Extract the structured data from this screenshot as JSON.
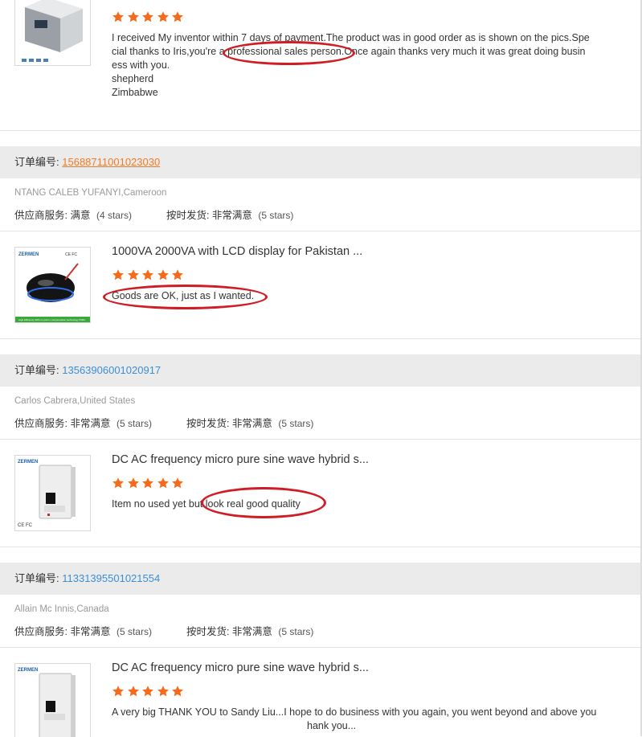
{
  "review1": {
    "text_lines": [
      "I received My inventor within 7 days of payment.The product was in good order as is shown on the pics.Spe",
      "cial thanks to Iris,you're a professional sales person.Once again thanks very much it was great doing busin",
      "ess with you.",
      "shepherd",
      "Zimbabwe"
    ],
    "rating": 5
  },
  "order1": {
    "label": "订单编号:",
    "number": "15688711001023030",
    "buyer": "NTANG CALEB YUFANYI,Cameroon",
    "service_label": "供应商服务:",
    "service_value": "满意",
    "service_stars": "(4 stars)",
    "delivery_label": "按时发货:",
    "delivery_value": "非常满意",
    "delivery_stars": "(5 stars)",
    "product_title": "1000VA 2000VA with LCD display for Pakistan ...",
    "rating": 5,
    "review": "Goods are OK, just as I wanted."
  },
  "order2": {
    "label": "订单编号:",
    "number": "13563906001020917",
    "buyer": "Carlos Cabrera,United States",
    "service_label": "供应商服务:",
    "service_value": "非常满意",
    "service_stars": "(5 stars)",
    "delivery_label": "按时发货:",
    "delivery_value": "非常满意",
    "delivery_stars": "(5 stars)",
    "product_title": "DC AC frequency micro pure sine wave hybrid s...",
    "rating": 5,
    "review": "Item no used yet  but look real good quality"
  },
  "order3": {
    "label": "订单编号:",
    "number": "11331395501021554",
    "buyer": "Allain Mc Innis,Canada",
    "service_label": "供应商服务:",
    "service_value": "非常满意",
    "service_stars": "(5 stars)",
    "delivery_label": "按时发货:",
    "delivery_value": "非常满意",
    "delivery_stars": "(5 stars)",
    "product_title": "DC AC frequency micro pure sine wave hybrid s...",
    "rating": 5,
    "review_lines": [
      "A very big THANK YOU to Sandy Liu...I hope to do business with you again, you went beyond and above you",
      "hank you..."
    ]
  },
  "thumb_logo_text": "ZERMEN",
  "thumb_caption": "High Efficiency 93% no pull-in compensation technology PWM",
  "colors": {
    "star": "#f56b1c",
    "order_link": "#3b8ed6",
    "order_link_visited": "#f07b26",
    "highlight_ellipse": "#d01c24",
    "order_bar": "#ebebeb"
  }
}
